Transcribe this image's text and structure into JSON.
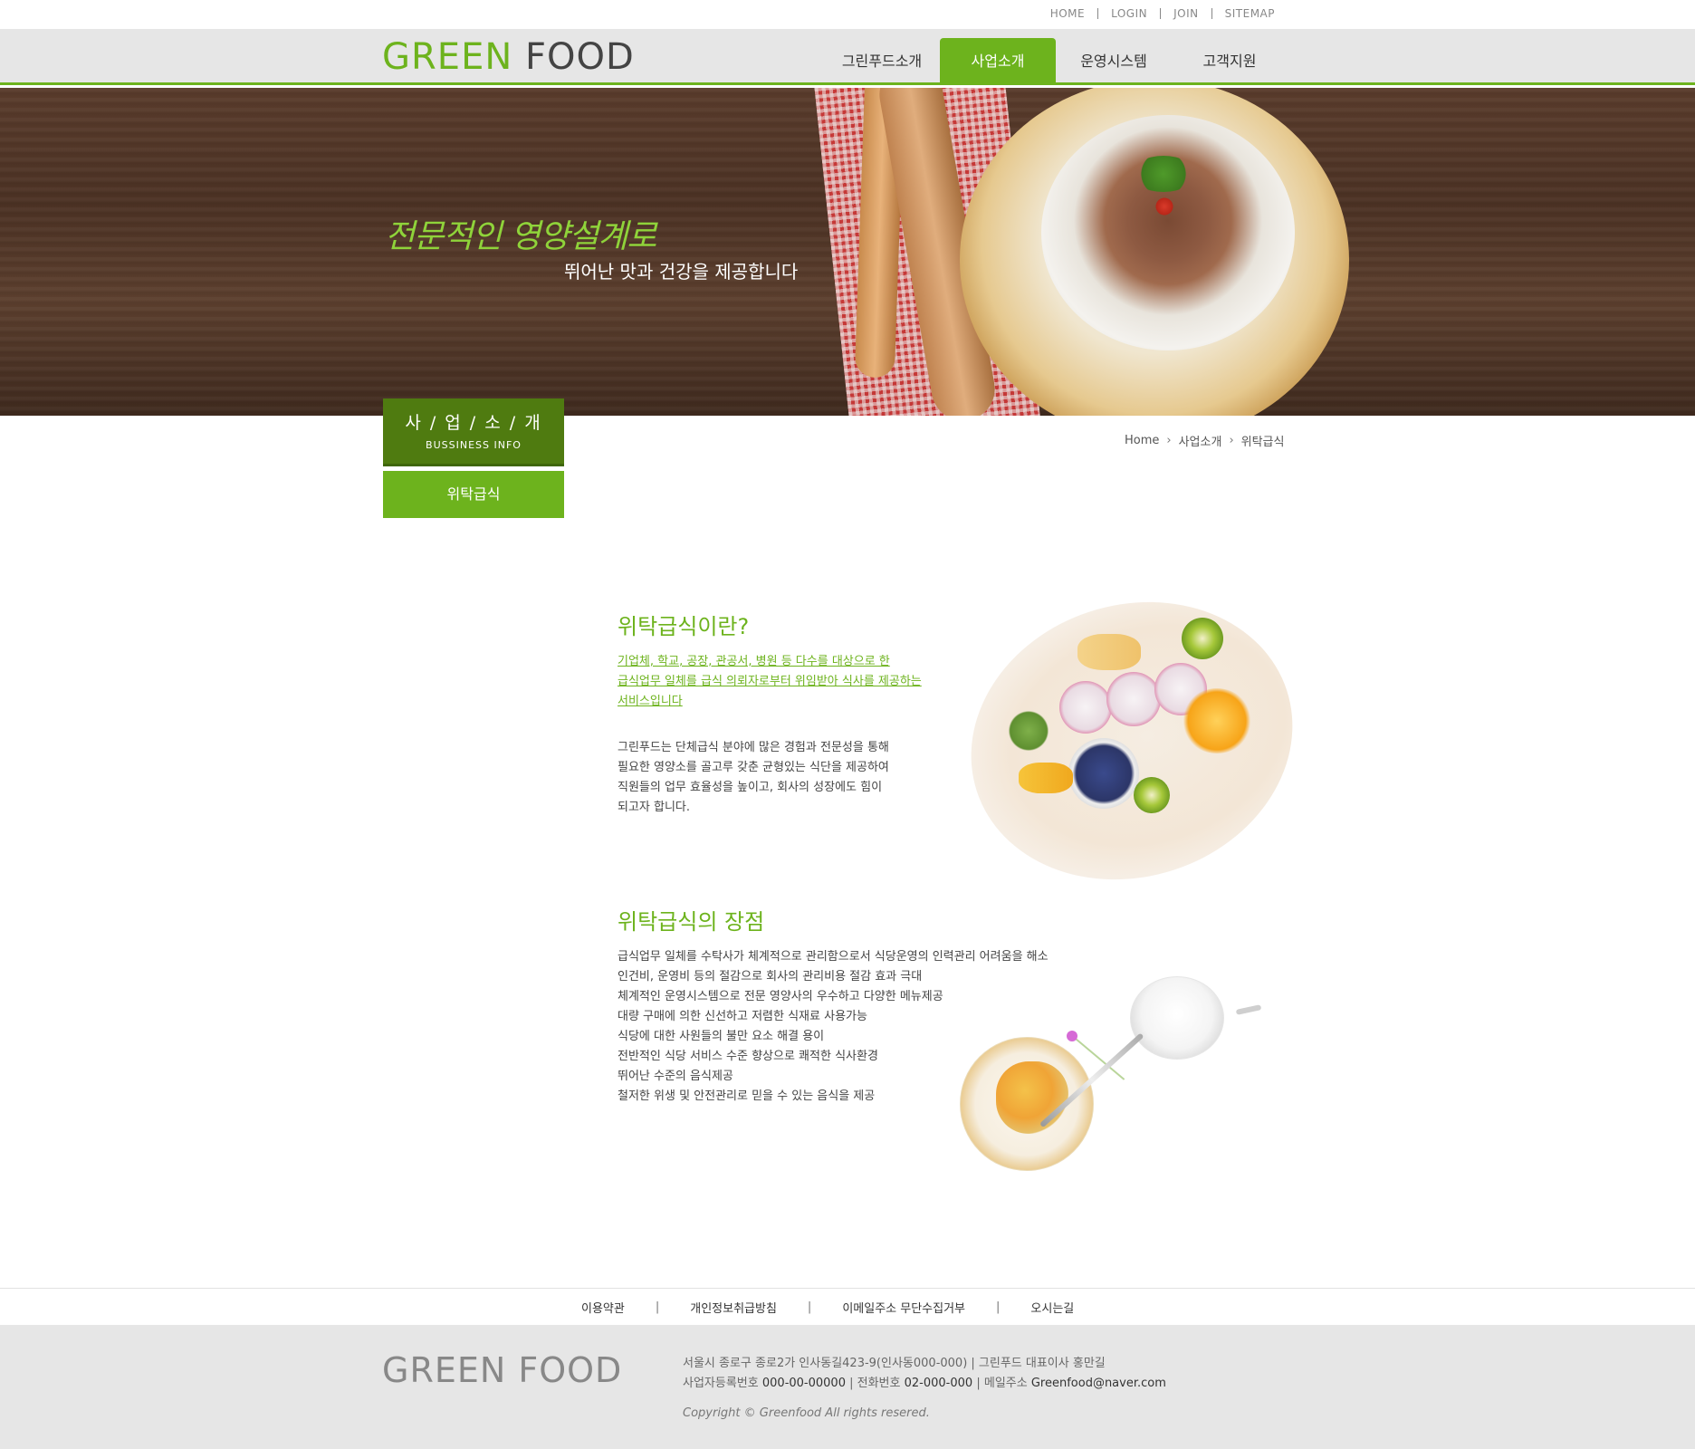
{
  "top_links": [
    "HOME",
    "LOGIN",
    "JOIN",
    "SITEMAP"
  ],
  "logo": {
    "green": "GREEN",
    "dark": "FOOD"
  },
  "nav": [
    {
      "label": "그린푸드소개",
      "active": false
    },
    {
      "label": "사업소개",
      "active": true
    },
    {
      "label": "운영시스템",
      "active": false
    },
    {
      "label": "고객지원",
      "active": false
    }
  ],
  "hero": {
    "title": "전문적인 영양설계로",
    "subtitle": "뛰어난 맛과 건강을 제공합니다"
  },
  "sidebar": {
    "heading": "사 / 업 / 소 / 개",
    "subheading": "BUSSINESS INFO",
    "items": [
      "위탁급식"
    ]
  },
  "breadcrumb": [
    "Home",
    "사업소개",
    "위탁급식"
  ],
  "section1": {
    "title": "위탁급식이란?",
    "lead": [
      "기업체, 학교, 공장, 관공서, 병원 등 다수를 대상으로 한",
      "급식업무 일체를 급식 의뢰자로부터 위임받아 식사를 제공하는",
      "서비스입니다"
    ],
    "body": [
      "그린푸드는 단체급식 분야에 많은 경험과 전문성을 통해",
      "필요한 영양소를 골고루 갖춘 균형있는 식단을 제공하여",
      "직원들의 업무 효율성을 높이고, 회사의 성장에도 힘이",
      "되고자 합니다."
    ]
  },
  "section2": {
    "title": "위탁급식의 장점",
    "items": [
      "급식업무 일체를 수탁사가 체계적으로 관리함으로서 식당운영의 인력관리 어려움을 해소",
      "인건비, 운영비 등의 절감으로 회사의 관리비용 절감 효과 극대",
      "체계적인 운영시스템으로 전문 영양사의 우수하고 다양한 메뉴제공",
      "대량 구매에 의한 신선하고 저렴한 식재료 사용가능",
      "식당에 대한 사원들의 불만 요소 해결 용이",
      "전반적인 식당 서비스 수준 향상으로 쾌적한 식사환경",
      "뛰어난 수준의 음식제공",
      "철저한 위생 및 안전관리로 믿을 수 있는 음식을 제공"
    ]
  },
  "footer_links": [
    "이용약관",
    "개인정보취급방침",
    "이메일주소 무단수집거부",
    "오시는길"
  ],
  "footer": {
    "logo": "GREEN FOOD",
    "address": "서울시 종로구 종로2가 인사동길423-9(인사동000-000) | 그린푸드 대표이사 홍만길",
    "biz_label": "사업자등록번호",
    "biz_no": "000-00-00000",
    "tel_label": "전화번호",
    "tel": "02-000-000",
    "mail_label": "메일주소",
    "mail": "Greenfood@naver.com",
    "copyright": "Copyright © Greenfood All rights resered."
  },
  "colors": {
    "accent": "#6db31d",
    "accent_dark": "#4f7b10",
    "header_bg": "#e6e6e6"
  },
  "icons": {
    "breadcrumb_separator": "chevron-right-icon"
  }
}
